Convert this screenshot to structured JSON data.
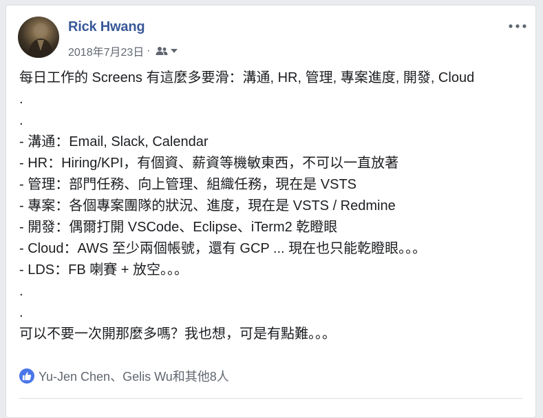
{
  "post": {
    "author": "Rick Hwang",
    "date": "2018年7月23日",
    "separator": "·",
    "audience_icon": "friends-icon",
    "more_icon": "more-options-icon",
    "lines": [
      "每日工作的 Screens 有這麼多要滑：溝通, HR, 管理, 專案進度, 開發, Cloud",
      ".",
      ".",
      "- 溝通：Email, Slack, Calendar",
      "- HR：Hiring/KPI，有個資、薪資等機敏東西，不可以一直放著",
      "- 管理：部門任務、向上管理、組織任務，現在是 VSTS",
      "- 專案：各個專案團隊的狀況、進度，現在是 VSTS / Redmine",
      "- 開發：偶爾打開 VSCode、Eclipse、iTerm2 乾瞪眼",
      "- Cloud：AWS 至少兩個帳號，還有 GCP ... 現在也只能乾瞪眼。。。",
      "- LDS：FB 喇賽 + 放空。。。",
      ".",
      ".",
      "可以不要一次開那麼多嗎？我也想，可是有點難。。。"
    ]
  },
  "reactions": {
    "icon": "like-icon",
    "text": "Yu-Jen Chen、Gelis Wu和其他8人",
    "color": "#4a76e8"
  },
  "colors": {
    "author": "#385898",
    "meta": "#616770",
    "body": "#1c1e21"
  }
}
